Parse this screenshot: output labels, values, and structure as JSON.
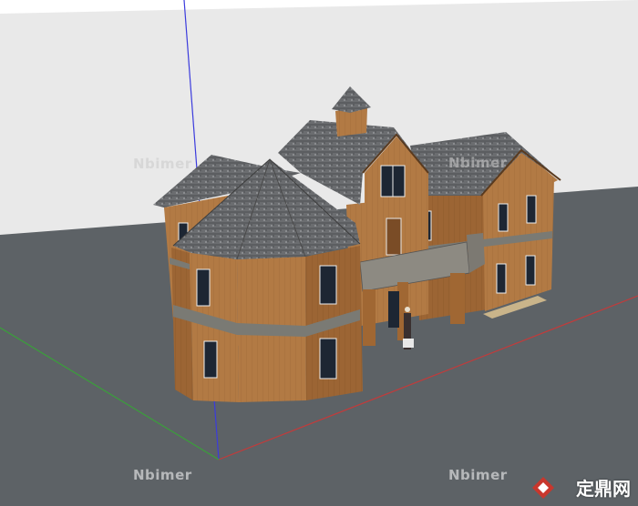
{
  "watermarks": {
    "top_left": "Nbimer",
    "top_right": "Nbimer",
    "bottom_left": "Nbimer",
    "bottom_right": "Nbimer"
  },
  "logo": {
    "brand": "定鼎网",
    "icon": "diamond-logo-icon",
    "color": "#c8372d"
  },
  "colors": {
    "sky": "#ebebeb",
    "ground": "#5f6468",
    "wood": "#b07a45",
    "roof": "#6a6a6a",
    "axis_blue": "#3a3adf",
    "axis_red": "#c53a3a",
    "axis_green": "#3aa33a"
  }
}
